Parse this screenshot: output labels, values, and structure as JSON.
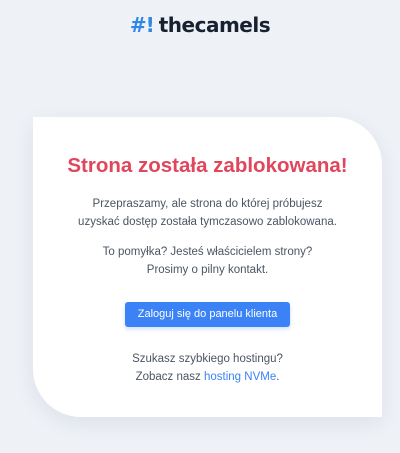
{
  "logo": {
    "mark": "#!",
    "name": "thecamels"
  },
  "card": {
    "title": "Strona została zablokowana!",
    "message_line1": "Przepraszamy, ale strona do której próbujesz",
    "message_line2": "uzyskać dostęp została tymczasowo zablokowana.",
    "owner_line1": "To pomyłka? Jesteś właścicielem strony?",
    "owner_line2": "Prosimy o pilny kontakt.",
    "button_label": "Zaloguj się do panelu klienta",
    "hosting_line1": "Szukasz szybkiego hostingu?",
    "hosting_prefix": "Zobacz nasz ",
    "hosting_link": "hosting NVMe",
    "hosting_suffix": "."
  },
  "colors": {
    "accent": "#3b82f6",
    "title": "#e0465c",
    "background": "#eef1f6"
  }
}
